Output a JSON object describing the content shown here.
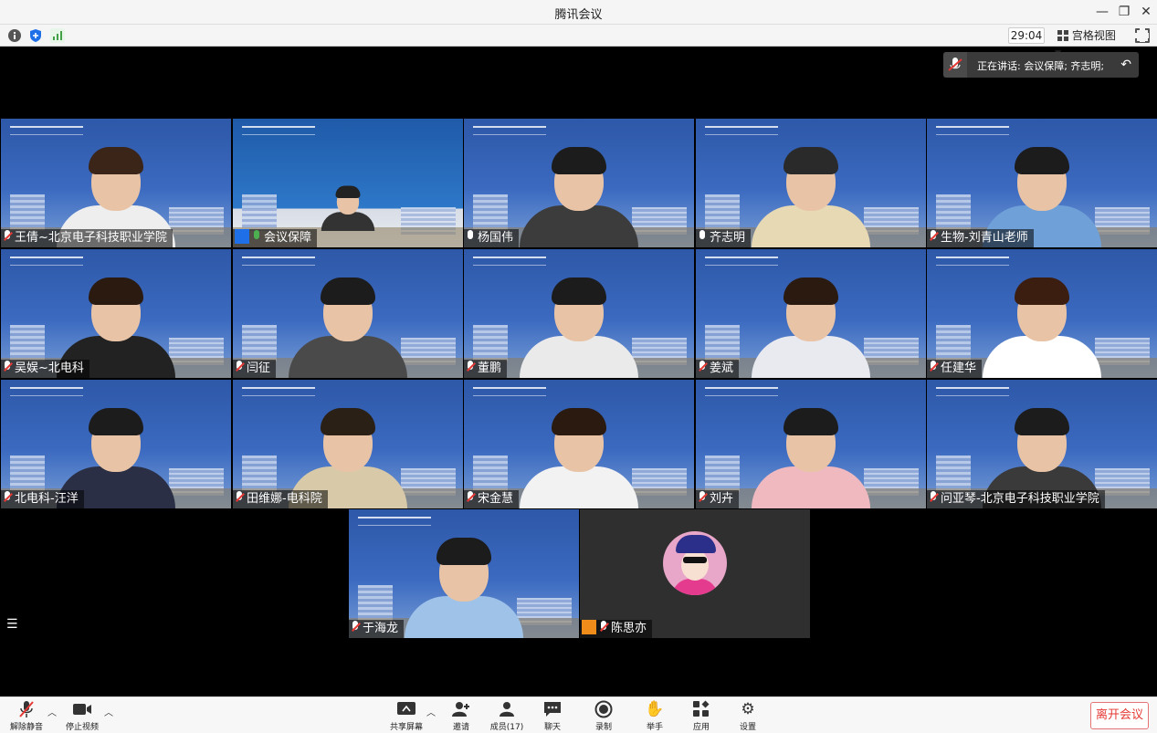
{
  "window": {
    "title": "腾讯会议"
  },
  "toolbar": {
    "timer": "29:04",
    "view_label": "宫格视图"
  },
  "speaking": {
    "label": "正在讲话: 会议保障; 齐志明;"
  },
  "participants": [
    {
      "name": "王倩~北京电子科技职业学院",
      "muted": true
    },
    {
      "name": "会议保障",
      "muted": false,
      "host": true
    },
    {
      "name": "杨国伟",
      "muted": false
    },
    {
      "name": "齐志明",
      "muted": false
    },
    {
      "name": "生物-刘青山老师",
      "muted": true
    },
    {
      "name": "吴娱~北电科",
      "muted": true
    },
    {
      "name": "闫征",
      "muted": true
    },
    {
      "name": "董鹏",
      "muted": true
    },
    {
      "name": "姜斌",
      "muted": true
    },
    {
      "name": "任建华",
      "muted": true
    },
    {
      "name": "北电科-汪洋",
      "muted": true
    },
    {
      "name": "田维娜-电科院",
      "muted": true
    },
    {
      "name": "宋金慧",
      "muted": true
    },
    {
      "name": "刘卉",
      "muted": true
    },
    {
      "name": "问亚琴-北京电子科技职业学院",
      "muted": true
    },
    {
      "name": "于海龙",
      "muted": true
    },
    {
      "name": "陈思亦",
      "muted": true,
      "host": true
    }
  ],
  "bottombar": {
    "unmute": "解除静音",
    "stop_video": "停止视频",
    "share": "共享屏幕",
    "invite": "邀请",
    "members": "成员(17)",
    "chat": "聊天",
    "record": "录制",
    "raise_hand": "举手",
    "apps": "应用",
    "settings": "设置",
    "leave": "离开会议"
  },
  "colors": {
    "accent": "#1e6fe8",
    "leave": "#e53935",
    "tile_bg": "#2e58a8"
  }
}
